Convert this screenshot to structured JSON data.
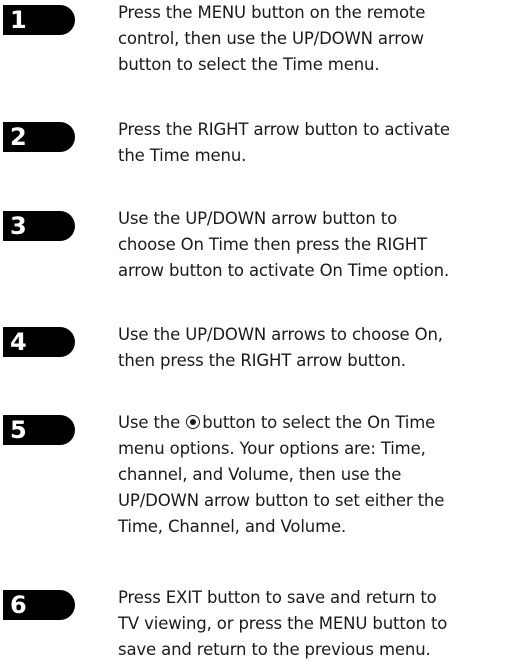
{
  "steps": [
    {
      "number": "1",
      "lines": [
        "Press the MENU button on the remote",
        "control, then use the UP/DOWN arrow",
        "button to select the Time menu."
      ]
    },
    {
      "number": "2",
      "lines": [
        "Press the RIGHT arrow button to activate",
        "the Time menu."
      ]
    },
    {
      "number": "3",
      "lines": [
        "Use the UP/DOWN arrow button to",
        "choose On Time then press the RIGHT",
        "arrow button to activate On Time option."
      ]
    },
    {
      "number": "4",
      "lines": [
        "Use the UP/DOWN arrows to choose On,",
        "then press the RIGHT arrow button."
      ]
    },
    {
      "number": "5",
      "line1_before_icon": "Use the",
      "icon": "target-button-icon",
      "line1_after_icon": "button to select the On Time",
      "lines": [
        "menu options. Your options are: Time,",
        "channel, and Volume, then use the",
        "UP/DOWN arrow button to set either the",
        "Time, Channel, and Volume."
      ]
    },
    {
      "number": "6",
      "lines": [
        "Press EXIT button to save and return to",
        "TV viewing, or press the MENU button to",
        "save and return to the previous menu."
      ]
    }
  ]
}
